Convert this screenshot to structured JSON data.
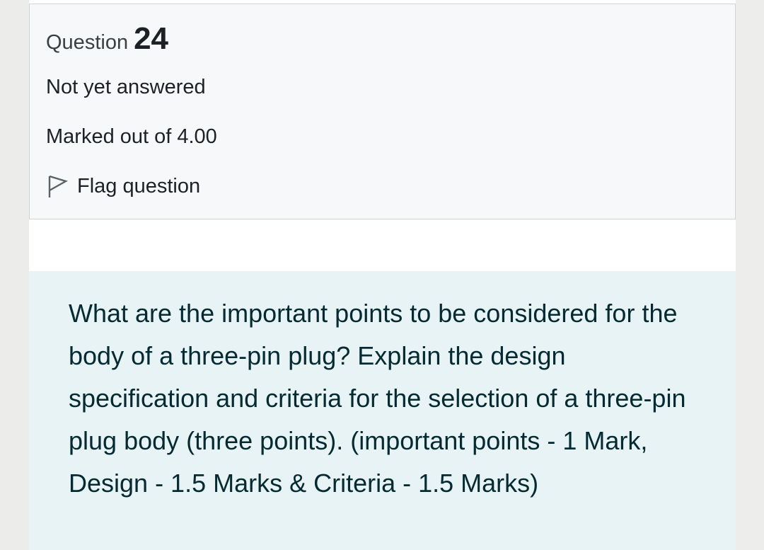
{
  "question_info": {
    "label": "Question",
    "number": "24",
    "state": "Not yet answered",
    "grade": "Marked out of 4.00",
    "flag_label": "Flag question",
    "flag_icon": "flag-outline-icon"
  },
  "question_text": "What are the important points to be considered for the body of a three-pin plug? Explain the design specification and criteria for the selection of a three-pin plug body (three points). (important points - 1 Mark, Design - 1.5 Marks & Criteria - 1.5 Marks)",
  "colors": {
    "info_background": "#f7f8fa",
    "info_border": "#cfd2d6",
    "question_background": "#e7f3f5",
    "question_text": "#062a31",
    "text": "#1d2125"
  }
}
